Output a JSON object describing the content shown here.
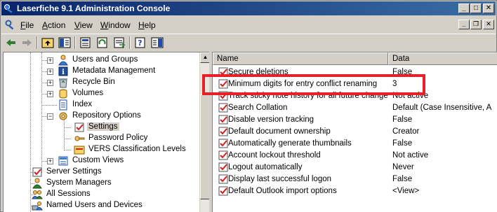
{
  "window": {
    "title": "Laserfiche 9.1 Administration Console",
    "controls": {
      "minimize": "_",
      "maximize": "□",
      "close": "✕"
    }
  },
  "menu": {
    "items": [
      {
        "label": "File",
        "key": "F",
        "rest": "ile"
      },
      {
        "label": "Action",
        "key": "A",
        "rest": "ction"
      },
      {
        "label": "View",
        "key": "V",
        "rest": "iew"
      },
      {
        "label": "Window",
        "key": "W",
        "rest": "indow"
      },
      {
        "label": "Help",
        "key": "H",
        "rest": "elp"
      }
    ],
    "mdi_controls": {
      "minimize": "_",
      "restore": "❐",
      "close": "✕"
    }
  },
  "toolbar": {
    "icons": [
      "back-icon",
      "forward-icon",
      "up-folder-icon",
      "show-hide-tree-icon",
      "properties-icon",
      "refresh-icon",
      "export-list-icon",
      "help-icon",
      "show-action-pane-icon"
    ]
  },
  "tree": {
    "nodes": [
      {
        "label": "Users and Groups",
        "icon": "users-icon"
      },
      {
        "label": "Metadata Management",
        "icon": "metadata-icon"
      },
      {
        "label": "Recycle Bin",
        "icon": "recycle-bin-icon"
      },
      {
        "label": "Volumes",
        "icon": "volumes-icon"
      },
      {
        "label": "Index",
        "icon": "index-icon"
      },
      {
        "label": "Repository Options",
        "icon": "repository-options-icon"
      },
      {
        "label": "Settings",
        "icon": "settings-check-icon"
      },
      {
        "label": "Password Policy",
        "icon": "password-policy-icon"
      },
      {
        "label": "VERS Classification Levels",
        "icon": "classification-icon"
      },
      {
        "label": "Custom Views",
        "icon": "custom-views-icon"
      },
      {
        "label": "Server Settings",
        "icon": "server-settings-icon"
      },
      {
        "label": "System Managers",
        "icon": "system-managers-icon"
      },
      {
        "label": "All Sessions",
        "icon": "sessions-icon"
      },
      {
        "label": "Named Users and Devices",
        "icon": "named-users-icon"
      }
    ]
  },
  "list": {
    "columns": {
      "name": "Name",
      "data": "Data"
    },
    "rows": [
      {
        "name": "Secure deletions",
        "value": "False"
      },
      {
        "name": "Minimum digits for entry conflict renaming",
        "value": "3"
      },
      {
        "name": "Track sticky note history for all future changes",
        "value": "Not active"
      },
      {
        "name": "Search Collation",
        "value": "Default (Case Insensitive, A"
      },
      {
        "name": "Disable version tracking",
        "value": "False"
      },
      {
        "name": "Default document ownership",
        "value": "Creator"
      },
      {
        "name": "Automatically generate thumbnails",
        "value": "False"
      },
      {
        "name": "Account lockout threshold",
        "value": "Not active"
      },
      {
        "name": "Logout automatically",
        "value": "Never"
      },
      {
        "name": "Display last successful logon",
        "value": "False"
      },
      {
        "name": "Default Outlook import options",
        "value": "<View>"
      }
    ]
  },
  "colors": {
    "title_start": "#0a246a",
    "title_end": "#3a6ea5",
    "highlight": "#e8202a",
    "face": "#d4d0c8"
  }
}
